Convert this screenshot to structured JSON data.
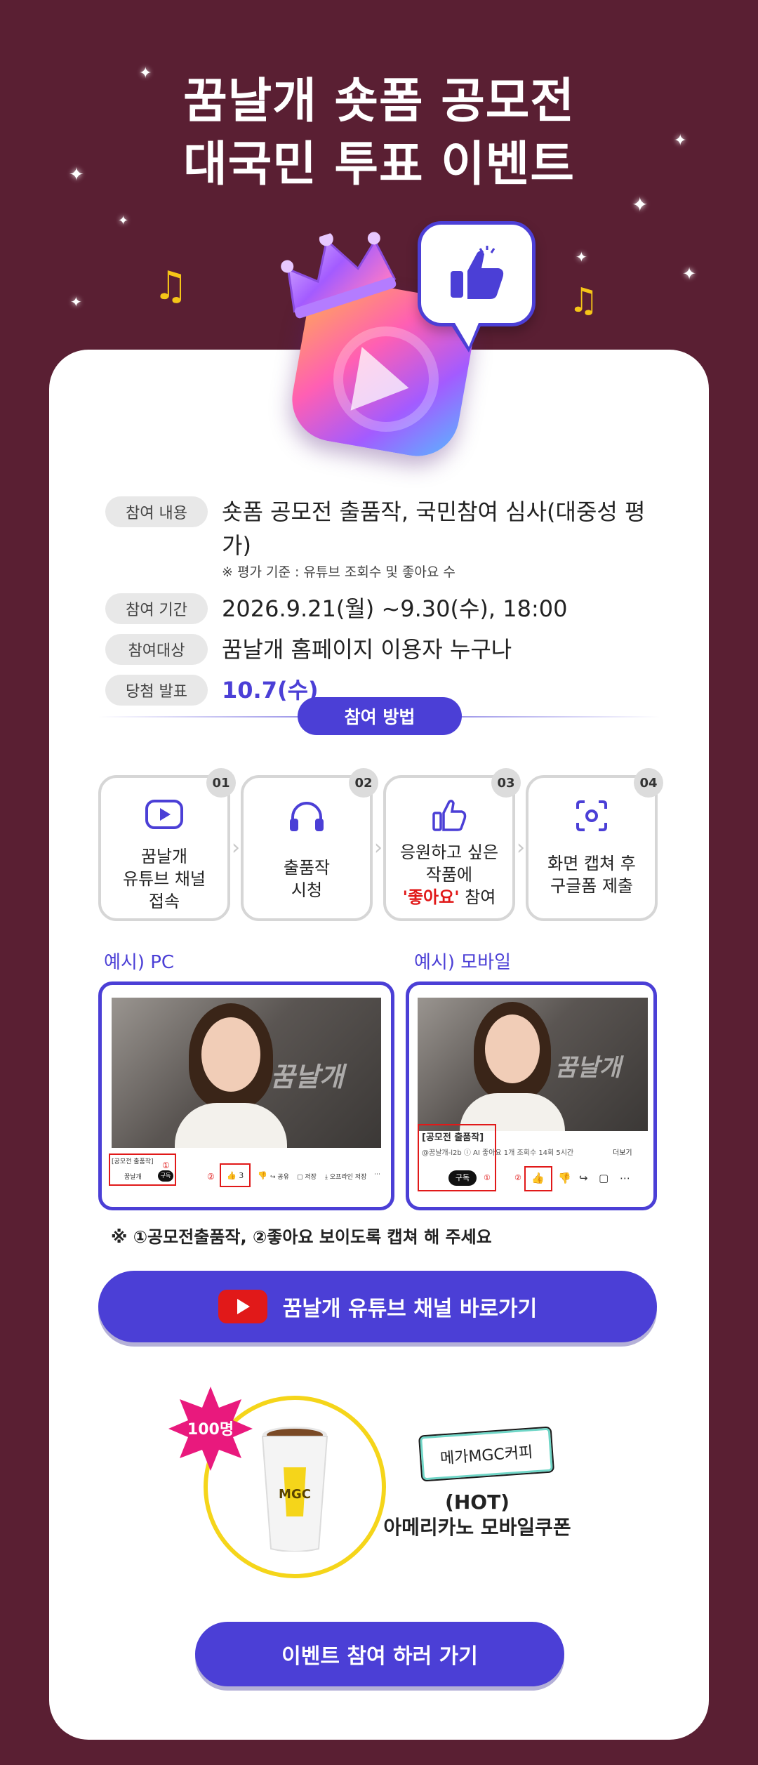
{
  "hero": {
    "title_line1": "꿈날개 숏폼 공모전",
    "title_line2": "대국민 투표 이벤트"
  },
  "info": {
    "rows": [
      {
        "label": "참여 내용",
        "value": "숏폼 공모전 출품작, 국민참여 심사(대중성 평가)",
        "sub": "※ 평가 기준 : 유튜브 조회수 및 좋아요 수"
      },
      {
        "label": "참여 기간",
        "value": "2026.9.21(월) ~9.30(수), 18:00"
      },
      {
        "label": "참여대상",
        "value": "꿈날개 홈페이지 이용자 누구나"
      },
      {
        "label": "당첨 발표",
        "value": "10.7(수)"
      }
    ]
  },
  "method": {
    "title": "참여 방법",
    "steps": [
      {
        "num": "01",
        "icon": "play-icon",
        "line1": "꿈날개",
        "line2": "유튜브 채널",
        "line3": "접속"
      },
      {
        "num": "02",
        "icon": "headphones-icon",
        "line1": "출품작",
        "line2": "시청"
      },
      {
        "num": "03",
        "icon": "thumbs-up-icon",
        "line1": "응원하고 싶은",
        "line2": "작품에",
        "line3_red": "'좋아요'",
        "line3_rest": " 참여"
      },
      {
        "num": "04",
        "icon": "screen-capture-icon",
        "line1": "화면 캡쳐 후",
        "line2": "구글폼 제출"
      }
    ]
  },
  "examples": {
    "pc_label": "예시) PC",
    "mobile_label": "예시) 모바일",
    "watermark": "꿈날개",
    "pc": {
      "title": "[공모전 출품작]",
      "channel": "꿈날개",
      "subscribe": "구독",
      "circle1": "①",
      "circle2": "②",
      "actions": [
        "공유",
        "저장",
        "오프라인 저장"
      ]
    },
    "mobile": {
      "title": "[공모전 출품작]",
      "meta": "@꿈날개-l2b  ⓘ AI 좋아요 1개  조회수 14회  5시간",
      "more": "더보기",
      "subscribe": "구독",
      "circle1": "①",
      "circle2": "②"
    },
    "note": "※ ①공모전출품작, ②좋아요 보이도록 캡쳐 해 주세요"
  },
  "youtube_button": {
    "label": "꿈날개 유튜브 채널 바로가기"
  },
  "prize": {
    "count": "100명",
    "brand": "메가MGC커피",
    "cup_logo": "MGC",
    "title_line1": "(HOT)",
    "title_line2": "아메리카노 모바일쿠폰"
  },
  "cta": {
    "label": "이벤트 참여 하러 가기"
  },
  "colors": {
    "background": "#5a1f33",
    "accent": "#4b3fd6",
    "red": "#e11919",
    "gold": "#f5d51a"
  }
}
